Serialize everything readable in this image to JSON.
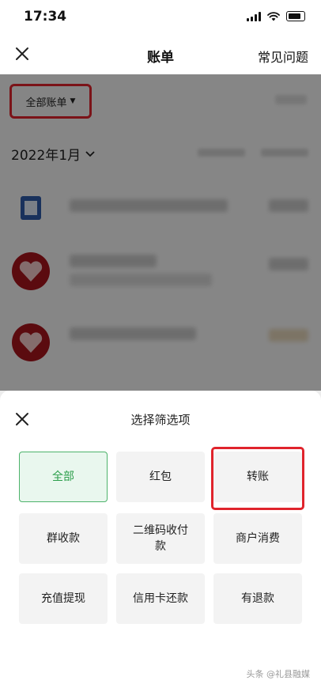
{
  "status_bar": {
    "time": "17:34"
  },
  "nav": {
    "title": "账单",
    "faq_label": "常见问题"
  },
  "filter": {
    "label": "全部账单"
  },
  "month": {
    "label": "2022年1月"
  },
  "sheet": {
    "title": "选择筛选项",
    "options": [
      {
        "label": "全部",
        "selected": true
      },
      {
        "label": "红包",
        "selected": false
      },
      {
        "label": "转账",
        "selected": false
      },
      {
        "label": "群收款",
        "selected": false
      },
      {
        "label": "二维码收付款",
        "selected": false
      },
      {
        "label": "商户消费",
        "selected": false
      },
      {
        "label": "充值提现",
        "selected": false
      },
      {
        "label": "信用卡还款",
        "selected": false
      },
      {
        "label": "有退款",
        "selected": false
      }
    ]
  },
  "watermark": "头条 @礼县融媒",
  "colors": {
    "highlight": "#e0242c",
    "selected_green": "#2b9e4a",
    "selected_bg": "#e9f7ee"
  },
  "icons": [
    "close-icon",
    "signal-icon",
    "wifi-icon",
    "battery-icon",
    "caret-down-icon",
    "chevron-down-icon"
  ]
}
